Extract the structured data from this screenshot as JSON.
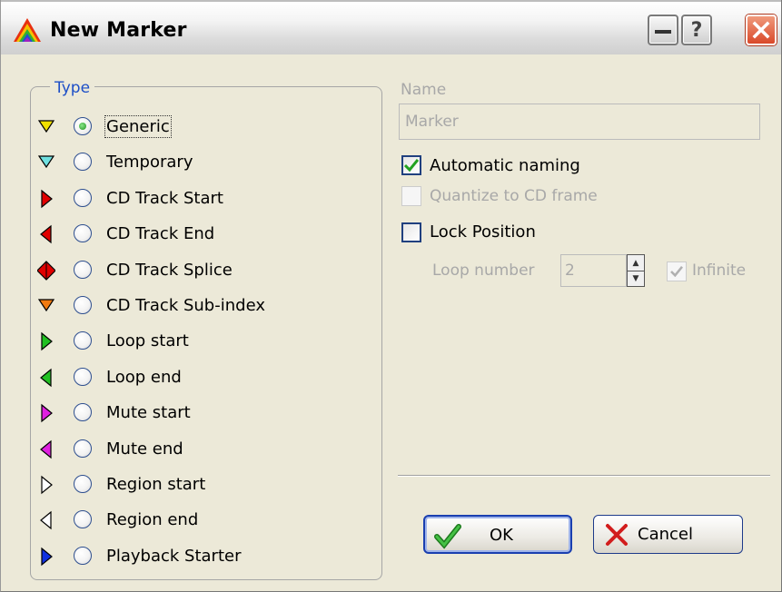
{
  "window": {
    "title": "New Marker",
    "help_glyph": "?"
  },
  "type_group": {
    "legend": "Type",
    "options": [
      {
        "label": "Generic",
        "marker_icon": "marker-down-triangle-icon",
        "color": "#f0e000",
        "selected": true
      },
      {
        "label": "Temporary",
        "marker_icon": "marker-down-triangle-icon",
        "color": "#6fe0e0",
        "selected": false
      },
      {
        "label": "CD Track Start",
        "marker_icon": "marker-right-triangle-icon",
        "color": "#e00000",
        "selected": false
      },
      {
        "label": "CD Track End",
        "marker_icon": "marker-left-triangle-icon",
        "color": "#e00000",
        "selected": false
      },
      {
        "label": "CD Track Splice",
        "marker_icon": "marker-diamond-icon",
        "color": "#e00000",
        "selected": false
      },
      {
        "label": "CD Track Sub-index",
        "marker_icon": "marker-down-triangle-icon",
        "color": "#f07a10",
        "selected": false
      },
      {
        "label": "Loop start",
        "marker_icon": "marker-right-triangle-icon",
        "color": "#22c022",
        "selected": false
      },
      {
        "label": "Loop end",
        "marker_icon": "marker-left-triangle-icon",
        "color": "#22c022",
        "selected": false
      },
      {
        "label": "Mute start",
        "marker_icon": "marker-right-triangle-icon",
        "color": "#e020e0",
        "selected": false
      },
      {
        "label": "Mute end",
        "marker_icon": "marker-left-triangle-icon",
        "color": "#e020e0",
        "selected": false
      },
      {
        "label": "Region start",
        "marker_icon": "marker-right-triangle-icon",
        "color": "#ffffff",
        "selected": false
      },
      {
        "label": "Region end",
        "marker_icon": "marker-left-triangle-icon",
        "color": "#ffffff",
        "selected": false
      },
      {
        "label": "Playback Starter",
        "marker_icon": "marker-right-triangle-icon",
        "color": "#1030e0",
        "selected": false
      }
    ]
  },
  "name": {
    "label": "Name",
    "value": "Marker"
  },
  "options": {
    "automatic_naming": {
      "label": "Automatic naming",
      "checked": true
    },
    "quantize": {
      "label": "Quantize to CD frame",
      "checked": false,
      "enabled": false
    },
    "lock_position": {
      "label": "Lock Position",
      "checked": false
    },
    "loop_number": {
      "label": "Loop number",
      "value": "2"
    },
    "infinite": {
      "label": "Infinite",
      "checked": true,
      "enabled": false
    }
  },
  "buttons": {
    "ok": "OK",
    "cancel": "Cancel"
  }
}
